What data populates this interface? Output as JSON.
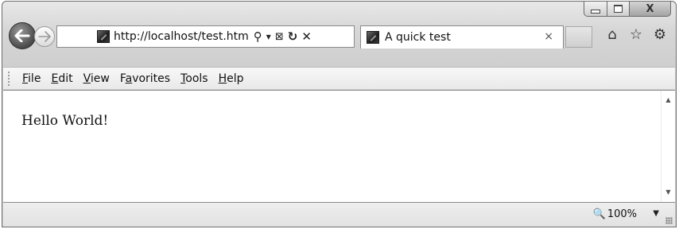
{
  "window": {
    "caption_buttons": {
      "minimize_icon": "minimize-icon",
      "maximize_icon": "maximize-icon",
      "close_icon": "close-icon",
      "close_glyph": "X"
    }
  },
  "nav": {
    "back_icon": "back-arrow-icon",
    "forward_icon": "forward-arrow-icon"
  },
  "address": {
    "url": "http://localhost/test.htm",
    "search_glyph": "⚲",
    "dropdown_glyph": "▾",
    "compat_glyph": "⊠",
    "refresh_glyph": "↻",
    "stop_glyph": "✕"
  },
  "tabs": [
    {
      "title": "A quick test",
      "close_glyph": "×"
    }
  ],
  "toolbar_right": {
    "home_glyph": "⌂",
    "favorites_glyph": "☆",
    "tools_glyph": "⚙"
  },
  "menu": [
    {
      "accel": "F",
      "rest": "ile"
    },
    {
      "accel": "E",
      "rest": "dit"
    },
    {
      "accel": "V",
      "rest": "iew"
    },
    {
      "pre": "F",
      "accel": "a",
      "rest": "vorites"
    },
    {
      "accel": "T",
      "rest": "ools"
    },
    {
      "accel": "H",
      "rest": "elp"
    }
  ],
  "page": {
    "body_text": "Hello World!"
  },
  "status": {
    "zoom_glyph": "🔍",
    "zoom_level": "100%",
    "dropdown_glyph": "▼"
  }
}
